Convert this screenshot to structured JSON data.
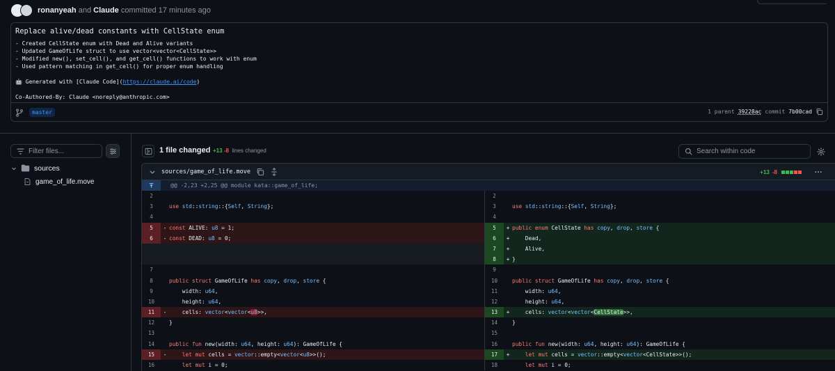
{
  "author": {
    "name": "ronanyeah",
    "conjunction": "and",
    "coauthor": "Claude",
    "action": "committed 17 minutes ago"
  },
  "commit": {
    "title": "Replace alive/dead constants with CellState enum",
    "body_lines": [
      "- Created CellState enum with Dead and Alive variants",
      "- Updated GameOfLife struct to use vector<vector<CellState>>",
      "- Modified new(), set_cell(), and get_cell() functions to work with enum",
      "- Used pattern matching in get_cell() for proper enum handling"
    ],
    "generated_prefix": "🤖 Generated with [Claude Code](",
    "generated_link": "https://claude.ai/code",
    "generated_suffix": ")",
    "coauthored": "Co-Authored-By: Claude <noreply@anthropic.com>",
    "branch": "master",
    "parent_label": "1 parent",
    "parent_sha": "39228ac",
    "commit_label": "commit",
    "commit_sha": "7b00cad"
  },
  "sidebar": {
    "filter_placeholder": "Filter files...",
    "folder": "sources",
    "file": "game_of_life.move"
  },
  "summary": {
    "files_changed": "1 file changed",
    "additions": "+13",
    "deletions": "-8",
    "lines_label": "lines changed",
    "search_placeholder": "Search within code"
  },
  "file": {
    "path": "sources/game_of_life.move",
    "additions": "+13",
    "deletions": "-8",
    "hunk": "@@ -2,23 +2,25 @@ module kata::game_of_life;"
  },
  "colors": {
    "add": "#3fb950",
    "del": "#f85149",
    "link": "#4493f8"
  },
  "diff_rows": [
    {
      "l": {
        "n": "2",
        "t": "ctx",
        "c": ""
      },
      "r": {
        "n": "2",
        "t": "ctx",
        "c": ""
      }
    },
    {
      "l": {
        "n": "3",
        "t": "ctx",
        "c": "use std::string::{Self, String};"
      },
      "r": {
        "n": "3",
        "t": "ctx",
        "c": "use std::string::{Self, String};"
      }
    },
    {
      "l": {
        "n": "4",
        "t": "ctx",
        "c": ""
      },
      "r": {
        "n": "4",
        "t": "ctx",
        "c": ""
      }
    },
    {
      "l": {
        "n": "5",
        "t": "del",
        "c": "const ALIVE: u8 = 1;"
      },
      "r": {
        "n": "5",
        "t": "add",
        "c": "public enum CellState has copy, drop, store {"
      }
    },
    {
      "l": {
        "n": "6",
        "t": "del",
        "c": "const DEAD: u8 = 0;"
      },
      "r": {
        "n": "6",
        "t": "add",
        "c": "    Dead,"
      }
    },
    {
      "l": {
        "n": "",
        "t": "empty",
        "c": ""
      },
      "r": {
        "n": "7",
        "t": "add",
        "c": "    Alive,"
      }
    },
    {
      "l": {
        "n": "",
        "t": "empty",
        "c": ""
      },
      "r": {
        "n": "8",
        "t": "add",
        "c": "}"
      }
    },
    {
      "l": {
        "n": "7",
        "t": "ctx",
        "c": ""
      },
      "r": {
        "n": "9",
        "t": "ctx",
        "c": ""
      }
    },
    {
      "l": {
        "n": "8",
        "t": "ctx",
        "c": "public struct GameOfLife has copy, drop, store {"
      },
      "r": {
        "n": "10",
        "t": "ctx",
        "c": "public struct GameOfLife has copy, drop, store {"
      }
    },
    {
      "l": {
        "n": "9",
        "t": "ctx",
        "c": "    width: u64,"
      },
      "r": {
        "n": "11",
        "t": "ctx",
        "c": "    width: u64,"
      }
    },
    {
      "l": {
        "n": "10",
        "t": "ctx",
        "c": "    height: u64,"
      },
      "r": {
        "n": "12",
        "t": "ctx",
        "c": "    height: u64,"
      }
    },
    {
      "l": {
        "n": "11",
        "t": "del",
        "c": "    cells: vector<vector<u8>>,"
      },
      "r": {
        "n": "13",
        "t": "add",
        "c": "    cells: vector<vector<CellState>>,"
      }
    },
    {
      "l": {
        "n": "12",
        "t": "ctx",
        "c": "}"
      },
      "r": {
        "n": "14",
        "t": "ctx",
        "c": "}"
      }
    },
    {
      "l": {
        "n": "13",
        "t": "ctx",
        "c": ""
      },
      "r": {
        "n": "15",
        "t": "ctx",
        "c": ""
      }
    },
    {
      "l": {
        "n": "14",
        "t": "ctx",
        "c": "public fun new(width: u64, height: u64): GameOfLife {"
      },
      "r": {
        "n": "16",
        "t": "ctx",
        "c": "public fun new(width: u64, height: u64): GameOfLife {"
      }
    },
    {
      "l": {
        "n": "15",
        "t": "del",
        "c": "    let mut cells = vector::empty<vector<u8>>();"
      },
      "r": {
        "n": "17",
        "t": "add",
        "c": "    let mut cells = vector::empty<vector<CellState>>();"
      }
    },
    {
      "l": {
        "n": "16",
        "t": "ctx",
        "c": "    let mut i = 0;"
      },
      "r": {
        "n": "18",
        "t": "ctx",
        "c": "    let mut i = 0;"
      }
    }
  ]
}
